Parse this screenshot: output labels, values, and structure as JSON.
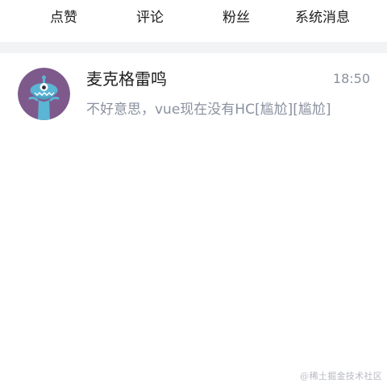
{
  "tabs": [
    {
      "label": "点赞"
    },
    {
      "label": "评论"
    },
    {
      "label": "粉丝"
    },
    {
      "label": "系统消息"
    }
  ],
  "messages": [
    {
      "sender": "麦克格雷鸣",
      "time": "18:50",
      "preview": "不好意思，vue现在没有HC[尴尬][尴尬]",
      "avatar_icon": "monster-avatar-icon"
    }
  ],
  "watermark": "@稀土掘金技术社区",
  "colors": {
    "background": "#ffffff",
    "divider": "#f2f3f5",
    "primary_text": "#1d1d1f",
    "secondary_text": "#8a919f",
    "avatar_bg": "#7e5a8c",
    "avatar_creature": "#5bb5d5"
  }
}
